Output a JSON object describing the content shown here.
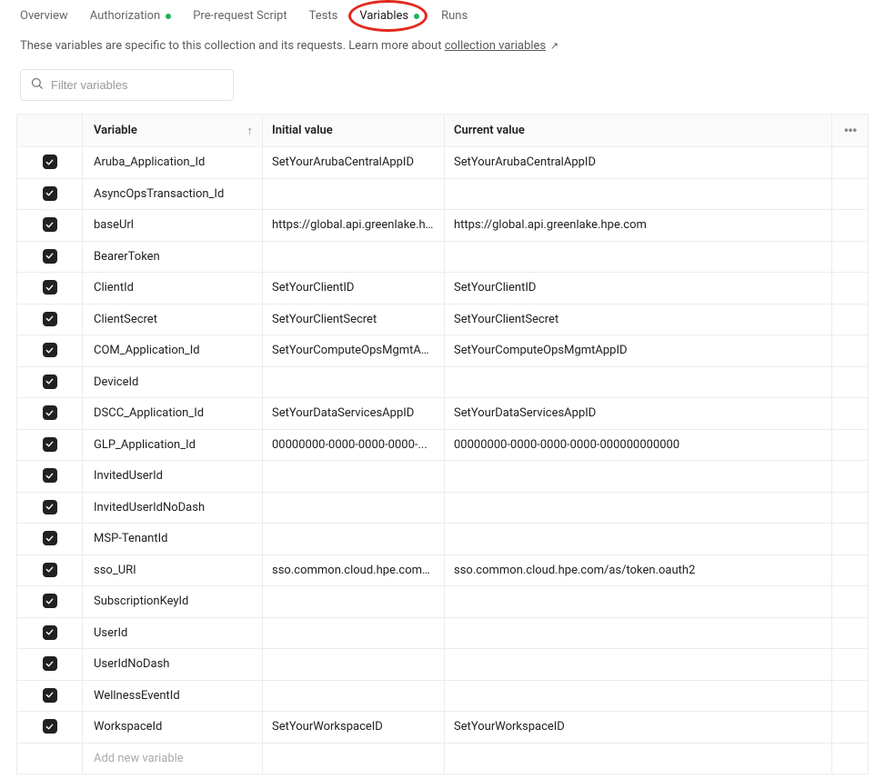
{
  "tabs": {
    "overview": "Overview",
    "authorization": "Authorization",
    "prerequest": "Pre-request Script",
    "tests": "Tests",
    "variables": "Variables",
    "runs": "Runs"
  },
  "description_prefix": "These variables are specific to this collection and its requests. Learn more about ",
  "description_link": "collection variables",
  "search": {
    "placeholder": "Filter variables"
  },
  "table": {
    "headers": {
      "variable": "Variable",
      "initial": "Initial value",
      "current": "Current value"
    },
    "add_placeholder": "Add new variable",
    "rows": [
      {
        "checked": true,
        "variable": "Aruba_Application_Id",
        "initial": "SetYourArubaCentralAppID",
        "current": "SetYourArubaCentralAppID"
      },
      {
        "checked": true,
        "variable": "AsyncOpsTransaction_Id",
        "initial": "",
        "current": ""
      },
      {
        "checked": true,
        "variable": "baseUrl",
        "initial": "https://global.api.greenlake.hp...",
        "current": "https://global.api.greenlake.hpe.com"
      },
      {
        "checked": true,
        "variable": "BearerToken",
        "initial": "",
        "current": ""
      },
      {
        "checked": true,
        "variable": "ClientId",
        "initial": "SetYourClientID",
        "current": "SetYourClientID"
      },
      {
        "checked": true,
        "variable": "ClientSecret",
        "initial": "SetYourClientSecret",
        "current": "SetYourClientSecret"
      },
      {
        "checked": true,
        "variable": "COM_Application_Id",
        "initial": "SetYourComputeOpsMgmtApp...",
        "current": "SetYourComputeOpsMgmtAppID"
      },
      {
        "checked": true,
        "variable": "DeviceId",
        "initial": "",
        "current": ""
      },
      {
        "checked": true,
        "variable": "DSCC_Application_Id",
        "initial": "SetYourDataServicesAppID",
        "current": "SetYourDataServicesAppID"
      },
      {
        "checked": true,
        "variable": "GLP_Application_Id",
        "initial": "00000000-0000-0000-0000-...",
        "current": "00000000-0000-0000-0000-000000000000"
      },
      {
        "checked": true,
        "variable": "InvitedUserId",
        "initial": "",
        "current": ""
      },
      {
        "checked": true,
        "variable": "InvitedUserIdNoDash",
        "initial": "",
        "current": ""
      },
      {
        "checked": true,
        "variable": "MSP-TenantId",
        "initial": "",
        "current": ""
      },
      {
        "checked": true,
        "variable": "sso_URI",
        "initial": "sso.common.cloud.hpe.com/a...",
        "current": "sso.common.cloud.hpe.com/as/token.oauth2"
      },
      {
        "checked": true,
        "variable": "SubscriptionKeyId",
        "initial": "",
        "current": ""
      },
      {
        "checked": true,
        "variable": "UserId",
        "initial": "",
        "current": ""
      },
      {
        "checked": true,
        "variable": "UserIdNoDash",
        "initial": "",
        "current": ""
      },
      {
        "checked": true,
        "variable": "WellnessEventId",
        "initial": "",
        "current": ""
      },
      {
        "checked": true,
        "variable": "WorkspaceId",
        "initial": "SetYourWorkspaceID",
        "current": "SetYourWorkspaceID"
      }
    ]
  }
}
